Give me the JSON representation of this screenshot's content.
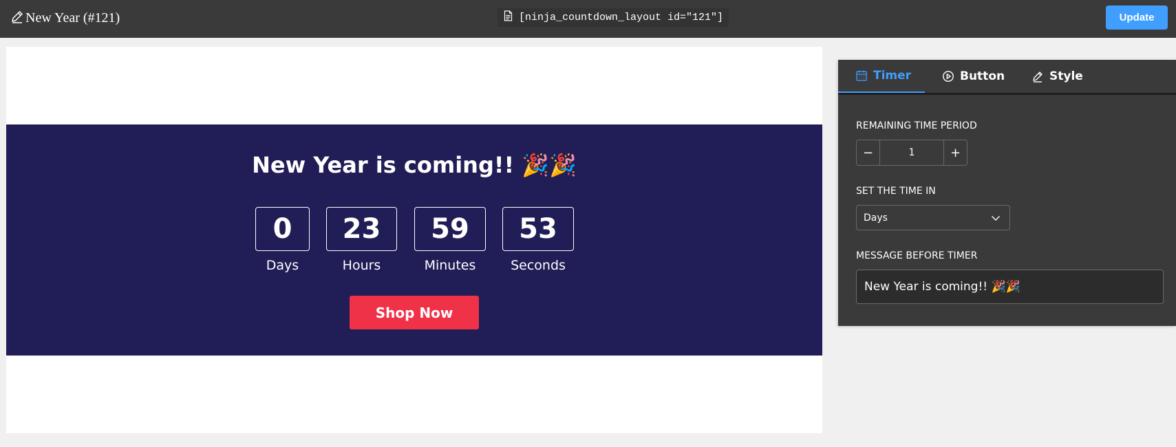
{
  "header": {
    "title": "New Year (#121)",
    "title_icon": "pencil-icon",
    "shortcode": "[ninja_countdown_layout id=\"121\"]",
    "shortcode_icon": "document-icon",
    "update_label": "Update"
  },
  "preview": {
    "heading": "New Year is coming!! 🎉🎉",
    "countdown": [
      {
        "value": "0",
        "label": "Days"
      },
      {
        "value": "23",
        "label": "Hours"
      },
      {
        "value": "59",
        "label": "Minutes"
      },
      {
        "value": "53",
        "label": "Seconds"
      }
    ],
    "button_label": "Shop Now"
  },
  "panel": {
    "tabs": [
      {
        "label": "Timer",
        "icon": "calendar-icon",
        "active": true
      },
      {
        "label": "Button",
        "icon": "play-circle-icon",
        "active": false
      },
      {
        "label": "Style",
        "icon": "pencil-icon",
        "active": false
      }
    ],
    "remaining_label": "REMAINING TIME PERIOD",
    "stepper": {
      "minus": "−",
      "value": "1",
      "plus": "+"
    },
    "time_in_label": "SET THE TIME IN",
    "time_in_value": "Days",
    "message_label": "MESSAGE BEFORE TIMER",
    "message_value": "New Year is coming!! 🎉🎉"
  },
  "colors": {
    "topbar": "#3a3a3b",
    "accent": "#409eff",
    "banner": "#211d56",
    "shop_button": "#ef3248",
    "panel": "#3a3a3b"
  }
}
